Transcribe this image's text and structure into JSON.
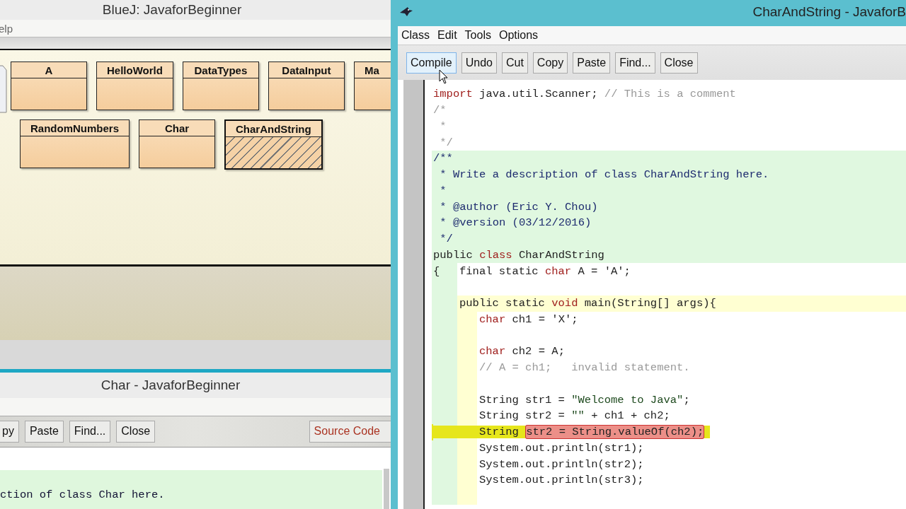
{
  "main_window": {
    "title": "BlueJ:  JavaforBeginner",
    "menu": [
      "elp"
    ],
    "class_rows": [
      {
        "classes": [
          {
            "name": "A",
            "compiled": true,
            "selected": false
          },
          {
            "name": "HelloWorld",
            "compiled": true,
            "selected": false
          },
          {
            "name": "DataTypes",
            "compiled": true,
            "selected": false
          },
          {
            "name": "DataInput",
            "compiled": true,
            "selected": false
          },
          {
            "name": "Ma",
            "compiled": true,
            "selected": false
          }
        ]
      },
      {
        "classes": [
          {
            "name": "RandomNumbers",
            "compiled": true,
            "selected": false
          },
          {
            "name": "Char",
            "compiled": true,
            "selected": false
          },
          {
            "name": "CharAndString",
            "compiled": false,
            "selected": true
          }
        ]
      }
    ]
  },
  "char_editor": {
    "title": "Char - JavaforBeginner",
    "toolbar": [
      "py",
      "Paste",
      "Find...",
      "Close"
    ],
    "view_selector": "Source Code",
    "code_line": "ction of class Char here."
  },
  "editor": {
    "title": "CharAndString - JavaforB",
    "menu": [
      "Class",
      "Edit",
      "Tools",
      "Options"
    ],
    "toolbar": [
      {
        "label": "Compile",
        "hovered": true
      },
      {
        "label": "Undo",
        "hovered": false
      },
      {
        "label": "Cut",
        "hovered": false
      },
      {
        "label": "Copy",
        "hovered": false
      },
      {
        "label": "Paste",
        "hovered": false
      },
      {
        "label": "Find...",
        "hovered": false
      },
      {
        "label": "Close",
        "hovered": false
      }
    ],
    "lines": [
      {
        "kind": "top",
        "error": false,
        "segments": [
          {
            "kind": "keyword",
            "text": "import"
          },
          {
            "kind": "plain",
            "text": " java.util.Scanner; "
          },
          {
            "kind": "comment",
            "text": "// This is a comment"
          }
        ]
      },
      {
        "kind": "top",
        "error": false,
        "segments": [
          {
            "kind": "comment",
            "text": "/*"
          }
        ]
      },
      {
        "kind": "top",
        "error": false,
        "segments": [
          {
            "kind": "comment",
            "text": " *"
          }
        ]
      },
      {
        "kind": "top",
        "error": false,
        "segments": [
          {
            "kind": "comment",
            "text": " */"
          }
        ]
      },
      {
        "kind": "class",
        "error": false,
        "segments": [
          {
            "kind": "doc",
            "text": "/**"
          }
        ]
      },
      {
        "kind": "class",
        "error": false,
        "segments": [
          {
            "kind": "doc",
            "text": " * Write a description of class CharAndString here."
          }
        ]
      },
      {
        "kind": "class",
        "error": false,
        "segments": [
          {
            "kind": "doc",
            "text": " *"
          }
        ]
      },
      {
        "kind": "class",
        "error": false,
        "segments": [
          {
            "kind": "doc",
            "text": " * @author (Eric Y. Chou)"
          }
        ]
      },
      {
        "kind": "class",
        "error": false,
        "segments": [
          {
            "kind": "doc",
            "text": " * @version (03/12/2016)"
          }
        ]
      },
      {
        "kind": "class",
        "error": false,
        "segments": [
          {
            "kind": "doc",
            "text": " */"
          }
        ]
      },
      {
        "kind": "class",
        "error": false,
        "segments": [
          {
            "kind": "plain",
            "text": "public "
          },
          {
            "kind": "keyword",
            "text": "class"
          },
          {
            "kind": "plain",
            "text": " CharAndString"
          }
        ]
      },
      {
        "kind": "member",
        "error": false,
        "lead": "{",
        "segments": [
          {
            "kind": "plain",
            "text": "final static "
          },
          {
            "kind": "keyword",
            "text": "char"
          },
          {
            "kind": "plain",
            "text": " A = 'A';"
          }
        ]
      },
      {
        "kind": "member",
        "error": false
      },
      {
        "kind": "method-head",
        "error": false,
        "segments": [
          {
            "kind": "plain",
            "text": "public static "
          },
          {
            "kind": "keyword",
            "text": "void"
          },
          {
            "kind": "plain",
            "text": " main(String[] args){"
          }
        ]
      },
      {
        "kind": "method-body",
        "error": false,
        "segments": [
          {
            "kind": "keyword",
            "text": "char"
          },
          {
            "kind": "plain",
            "text": " ch1 = 'X';"
          }
        ]
      },
      {
        "kind": "method-body",
        "error": false
      },
      {
        "kind": "method-body",
        "error": false,
        "segments": [
          {
            "kind": "keyword",
            "text": "char"
          },
          {
            "kind": "plain",
            "text": " ch2 = A;"
          }
        ]
      },
      {
        "kind": "method-body",
        "error": false,
        "segments": [
          {
            "kind": "comment",
            "text": "// A = ch1;   invalid statement."
          }
        ]
      },
      {
        "kind": "method-body",
        "error": false
      },
      {
        "kind": "method-body",
        "error": false,
        "segments": [
          {
            "kind": "plain",
            "text": "String str1 = "
          },
          {
            "kind": "string",
            "text": "\"Welcome to Java\""
          },
          {
            "kind": "plain",
            "text": ";"
          }
        ]
      },
      {
        "kind": "method-body",
        "error": false,
        "segments": [
          {
            "kind": "plain",
            "text": "String str2 = "
          },
          {
            "kind": "string",
            "text": "\"\""
          },
          {
            "kind": "plain",
            "text": " + ch1 + ch2;"
          }
        ]
      },
      {
        "kind": "method-body",
        "error": true,
        "segments": [
          {
            "kind": "plain",
            "text": "String "
          },
          {
            "kind": "selection",
            "text": "str2 = String.valueOf(ch2);"
          }
        ]
      },
      {
        "kind": "method-body",
        "error": false,
        "segments": [
          {
            "kind": "plain",
            "text": "System.out.println(str1);"
          }
        ]
      },
      {
        "kind": "method-body",
        "error": false,
        "segments": [
          {
            "kind": "plain",
            "text": "System.out.println(str2);"
          }
        ]
      },
      {
        "kind": "method-body",
        "error": false,
        "segments": [
          {
            "kind": "plain",
            "text": "System.out.println(str3);"
          }
        ]
      },
      {
        "kind": "method-body",
        "error": false
      }
    ]
  }
}
